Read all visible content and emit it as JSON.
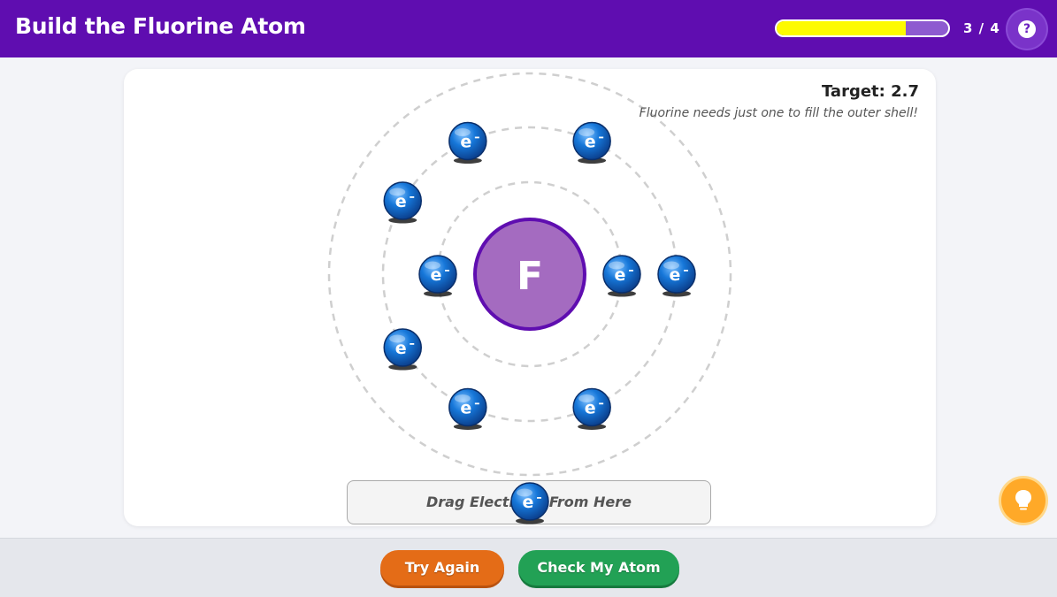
{
  "header": {
    "title": "Build the Fluorine Atom",
    "progress_fraction": 0.75,
    "progress_text": "3 / 4",
    "help_icon": "question-mark-icon",
    "help_label": "?"
  },
  "card": {
    "target_text": "Target: 2.7",
    "hint_text": "Fluorine needs just one to fill the outer shell!"
  },
  "atom": {
    "symbol": "F",
    "electron_label": "e",
    "shells": [
      {
        "name": "shell-1",
        "electrons": 2
      },
      {
        "name": "shell-2",
        "electrons": 7
      }
    ]
  },
  "tray": {
    "label": "Drag Electrons From Here"
  },
  "buttons": {
    "try_again": "Try Again",
    "check_atom": "Check My Atom"
  },
  "icons": {
    "hint": "lightbulb-icon",
    "electron": "electron-icon"
  },
  "colors": {
    "header": "#5f0db0",
    "progress_fill": "#fdfa00",
    "nucleus_fill": "#a46bc0",
    "nucleus_border": "#5f0db0",
    "electron": "#1677d9",
    "try_again": "#e46c17",
    "check_atom": "#22a155",
    "hint_button": "#ffa928"
  }
}
